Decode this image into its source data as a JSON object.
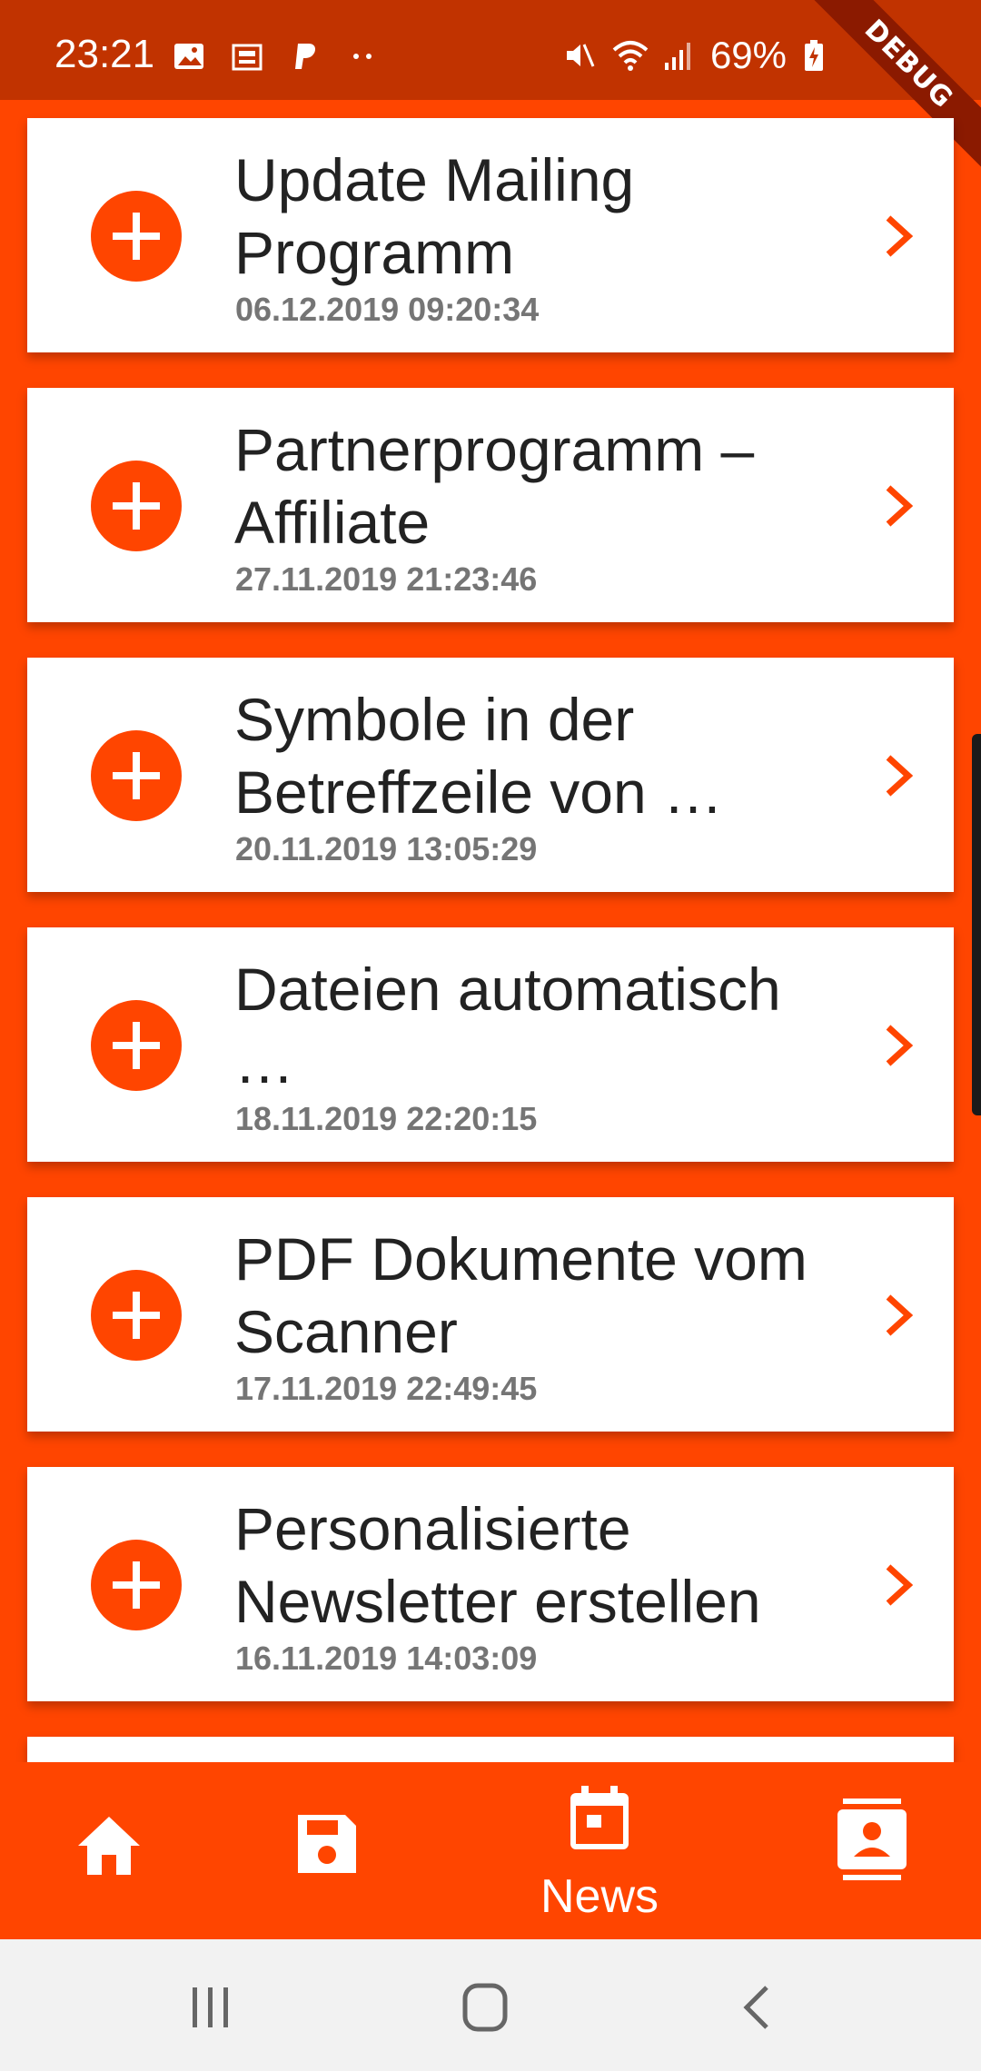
{
  "status_bar": {
    "time": "23:21",
    "battery": "69%",
    "debug_label": "DEBUG",
    "left_icons": [
      "gallery-icon",
      "news-icon",
      "paypal-icon",
      "more-dots-icon"
    ],
    "right_icons": [
      "mute-icon",
      "wifi-icon",
      "signal-icon",
      "battery-charging-icon"
    ]
  },
  "news": {
    "items": [
      {
        "title": "Update Mailing Programm",
        "date": "06.12.2019 09:20:34"
      },
      {
        "title": "Partnerprogramm – Affiliate",
        "date": "27.11.2019 21:23:46"
      },
      {
        "title": "Symbole in der Betreffzeile von …",
        "date": "20.11.2019 13:05:29"
      },
      {
        "title": "Dateien automatisch …",
        "date": "18.11.2019 22:20:15"
      },
      {
        "title": "PDF Dokumente vom Scanner",
        "date": "17.11.2019 22:49:45"
      },
      {
        "title": "Personalisierte Newsletter erstellen",
        "date": "16.11.2019 14:03:09"
      }
    ]
  },
  "bottom_nav": {
    "items": [
      {
        "icon": "home-icon",
        "label": ""
      },
      {
        "icon": "save-icon",
        "label": ""
      },
      {
        "icon": "calendar-icon",
        "label": "News"
      },
      {
        "icon": "contacts-icon",
        "label": ""
      }
    ]
  },
  "colors": {
    "accent": "#FF4500",
    "status_bar": "#C13300",
    "card": "#FFFFFF",
    "date_text": "#757575"
  }
}
